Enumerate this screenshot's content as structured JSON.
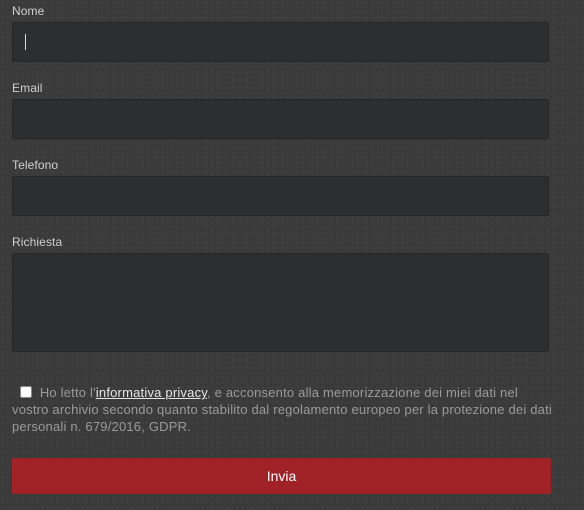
{
  "form": {
    "fields": [
      {
        "label": "Nome",
        "value": ""
      },
      {
        "label": "Email",
        "value": ""
      },
      {
        "label": "Telefono",
        "value": ""
      },
      {
        "label": "Richiesta",
        "value": ""
      }
    ],
    "consent": {
      "checked": false,
      "text_before": "Ho letto l'",
      "link_text": "informativa privacy",
      "text_after": ", e acconsento alla memorizzazione dei miei dati nel vostro archivio secondo quanto stabilito dal regolamento europeo per la protezione dei dati personali n. 679/2016, GDPR."
    },
    "submit_label": "Invia"
  },
  "colors": {
    "background": "#3b3b3b",
    "field_background": "#2c2e30",
    "submit_button": "#a02227"
  }
}
